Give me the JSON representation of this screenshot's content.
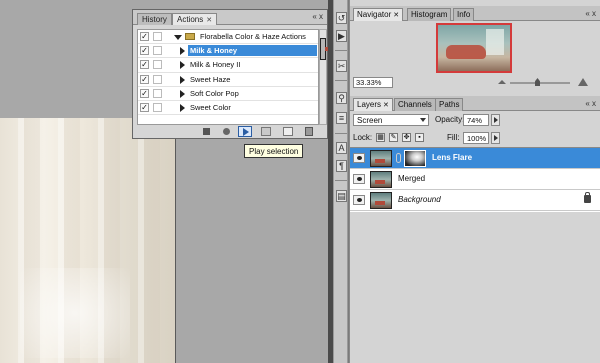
{
  "floating_panel": {
    "tabs": [
      {
        "label": "History",
        "active": false
      },
      {
        "label": "Actions",
        "active": true
      }
    ],
    "controls": "«  x",
    "actions": [
      {
        "label": "Florabella Color & Haze Actions",
        "type": "set",
        "checked": true,
        "selected": false
      },
      {
        "label": "Milk & Honey",
        "type": "action",
        "checked": true,
        "selected": true
      },
      {
        "label": "Milk & Honey II",
        "type": "action",
        "checked": true,
        "selected": false
      },
      {
        "label": "Sweet Haze",
        "type": "action",
        "checked": true,
        "selected": false
      },
      {
        "label": "Soft Color Pop",
        "type": "action",
        "checked": true,
        "selected": false
      },
      {
        "label": "Sweet Color",
        "type": "action",
        "checked": true,
        "selected": false
      }
    ],
    "bottom_icons": [
      "stop-icon",
      "record-icon",
      "play-icon",
      "folder-icon",
      "new-action-icon",
      "trash-icon"
    ]
  },
  "tooltip": "Play selection",
  "dock": {
    "icons": [
      "history-brush-icon",
      "actions-play-icon",
      "tools-icon",
      "layer-style-icon",
      "paragraph-icon",
      "character-icon",
      "pilcrow-icon",
      "layer-comps-icon"
    ]
  },
  "navigator_panel": {
    "tabs": [
      {
        "label": "Navigator",
        "active": true
      },
      {
        "label": "Histogram",
        "active": false
      },
      {
        "label": "Info",
        "active": false
      }
    ],
    "menu": "«  x",
    "zoom": "33.33%"
  },
  "layers_panel": {
    "tabs": [
      {
        "label": "Layers",
        "active": true
      },
      {
        "label": "Channels",
        "active": false
      },
      {
        "label": "Paths",
        "active": false
      }
    ],
    "blend_mode": "Screen",
    "opacity_label": "Opacity:",
    "opacity": "74%",
    "lock_label": "Lock:",
    "fill_label": "Fill:",
    "fill": "100%",
    "layers": [
      {
        "name": "Lens Flare",
        "selected": true,
        "has_mask": true,
        "style": "bold",
        "locked": false
      },
      {
        "name": "Merged",
        "selected": false,
        "has_mask": false,
        "style": "normal",
        "locked": false
      },
      {
        "name": "Background",
        "selected": false,
        "has_mask": false,
        "style": "italic",
        "locked": true
      }
    ]
  },
  "colors": {
    "selection": "#3a8ad8",
    "navigator_box": "#d43a3a",
    "tooltip_bg": "#ffffe1"
  }
}
